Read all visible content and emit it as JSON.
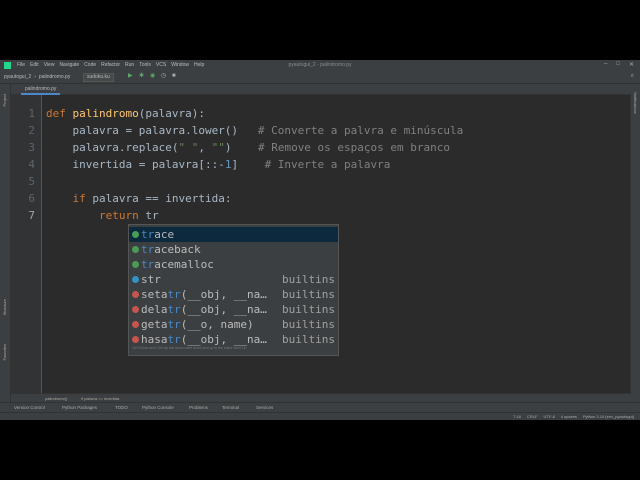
{
  "menubar": {
    "menus": [
      "File",
      "Edit",
      "View",
      "Navigate",
      "Code",
      "Refactor",
      "Run",
      "Tools",
      "VCS",
      "Window",
      "Help"
    ],
    "title": "pyautogui_2 - palindromo.py",
    "logo_color": "#21d789"
  },
  "toolbar": {
    "crumb_project": "pyautogui_2",
    "crumb_file": "palindromo.py",
    "run_config": "sudoku.ku"
  },
  "tab": {
    "label": "palindromo.py"
  },
  "left_tool_labels": [
    "Project",
    "Structure",
    "Favorites"
  ],
  "right_tool_labels": [
    "Notifications"
  ],
  "editor": {
    "line_numbers": [
      "1",
      "2",
      "3",
      "4",
      "5",
      "6",
      "7"
    ],
    "typed_text": "return tr"
  },
  "autocomplete": {
    "items": [
      {
        "prefix": "tr",
        "rest": "ace",
        "pre": "",
        "source": "",
        "icon_color": "#499c54",
        "selected": true
      },
      {
        "prefix": "tr",
        "rest": "aceback",
        "pre": "",
        "source": "",
        "icon_color": "#499c54",
        "selected": false
      },
      {
        "prefix": "tr",
        "rest": "acemalloc",
        "pre": "",
        "source": "",
        "icon_color": "#499c54",
        "selected": false
      },
      {
        "prefix": "",
        "rest": "str",
        "pre": "",
        "source": "builtins",
        "icon_color": "#3592c4",
        "selected": false
      },
      {
        "prefix": "tr",
        "rest": "(__obj, __na…",
        "pre": "seta",
        "source": "builtins",
        "icon_color": "#c7554f",
        "selected": false
      },
      {
        "prefix": "tr",
        "rest": "(__obj, __na…",
        "pre": "dela",
        "source": "builtins",
        "icon_color": "#c7554f",
        "selected": false
      },
      {
        "prefix": "tr",
        "rest": "(__o, name)",
        "pre": "geta",
        "source": "builtins",
        "icon_color": "#c7554f",
        "selected": false
      },
      {
        "prefix": "tr",
        "rest": "(__obj, __na…",
        "pre": "hasa",
        "source": "builtins",
        "icon_color": "#c7554f",
        "selected": false
      }
    ],
    "hint": "Ctrl+Down and Ctrl+Up will move caret down and up in the editor  Next Tip"
  },
  "breadcrumb_bottom": [
    "palindromo()",
    "if palavra == invertida"
  ],
  "bottom_tabs": [
    "Version Control",
    "Python Packages",
    "TODO",
    "Python Console",
    "Problems",
    "Terminal",
    "Services"
  ],
  "status": [
    "7:18",
    "CRLF",
    "UTF-8",
    "4 spaces",
    "Python 3.10 (env_pyautogui)"
  ]
}
